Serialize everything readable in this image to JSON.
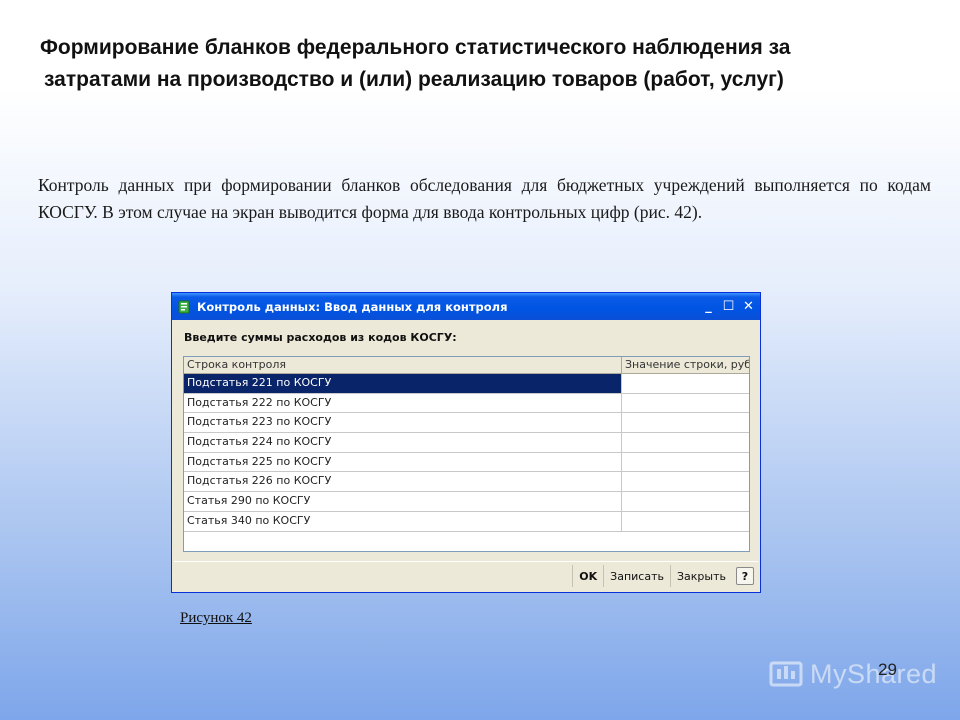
{
  "slide": {
    "title_line1": "Формирование бланков федерального статистического наблюдения за",
    "title_line2": "затратами на производство и (или) реализацию товаров (работ, услуг)",
    "body": "Контроль данных при формировании бланков обследования для бюджетных учреждений выполняется по кодам КОСГУ. В этом случае на экран выводится форма для ввода контрольных цифр (рис. 42).",
    "caption": "Рисунок 42",
    "page_number": "29",
    "watermark": "MyShared"
  },
  "window": {
    "title": "Контроль данных: Ввод данных для контроля",
    "prompt": "Введите суммы расходов из кодов КОСГУ:",
    "columns": [
      "Строка контроля",
      "Значение строки, рубли"
    ],
    "rows": [
      {
        "label": "Подстатья 221 по КОСГУ",
        "value": "",
        "selected": true
      },
      {
        "label": "Подстатья 222 по КОСГУ",
        "value": ""
      },
      {
        "label": "Подстатья 223 по КОСГУ",
        "value": ""
      },
      {
        "label": "Подстатья 224 по КОСГУ",
        "value": ""
      },
      {
        "label": "Подстатья 225 по КОСГУ",
        "value": ""
      },
      {
        "label": "Подстатья 226 по КОСГУ",
        "value": ""
      },
      {
        "label": "Статья 290 по КОСГУ",
        "value": ""
      },
      {
        "label": "Статья 340 по КОСГУ",
        "value": ""
      }
    ],
    "buttons": {
      "ok": "OK",
      "save": "Записать",
      "close": "Закрыть",
      "help": "?"
    },
    "titlebar_buttons": {
      "minimize": "_",
      "maximize": "☐",
      "close": "✕"
    }
  },
  "colors": {
    "titlebar": "#0054e3",
    "selection": "#0a246a"
  }
}
